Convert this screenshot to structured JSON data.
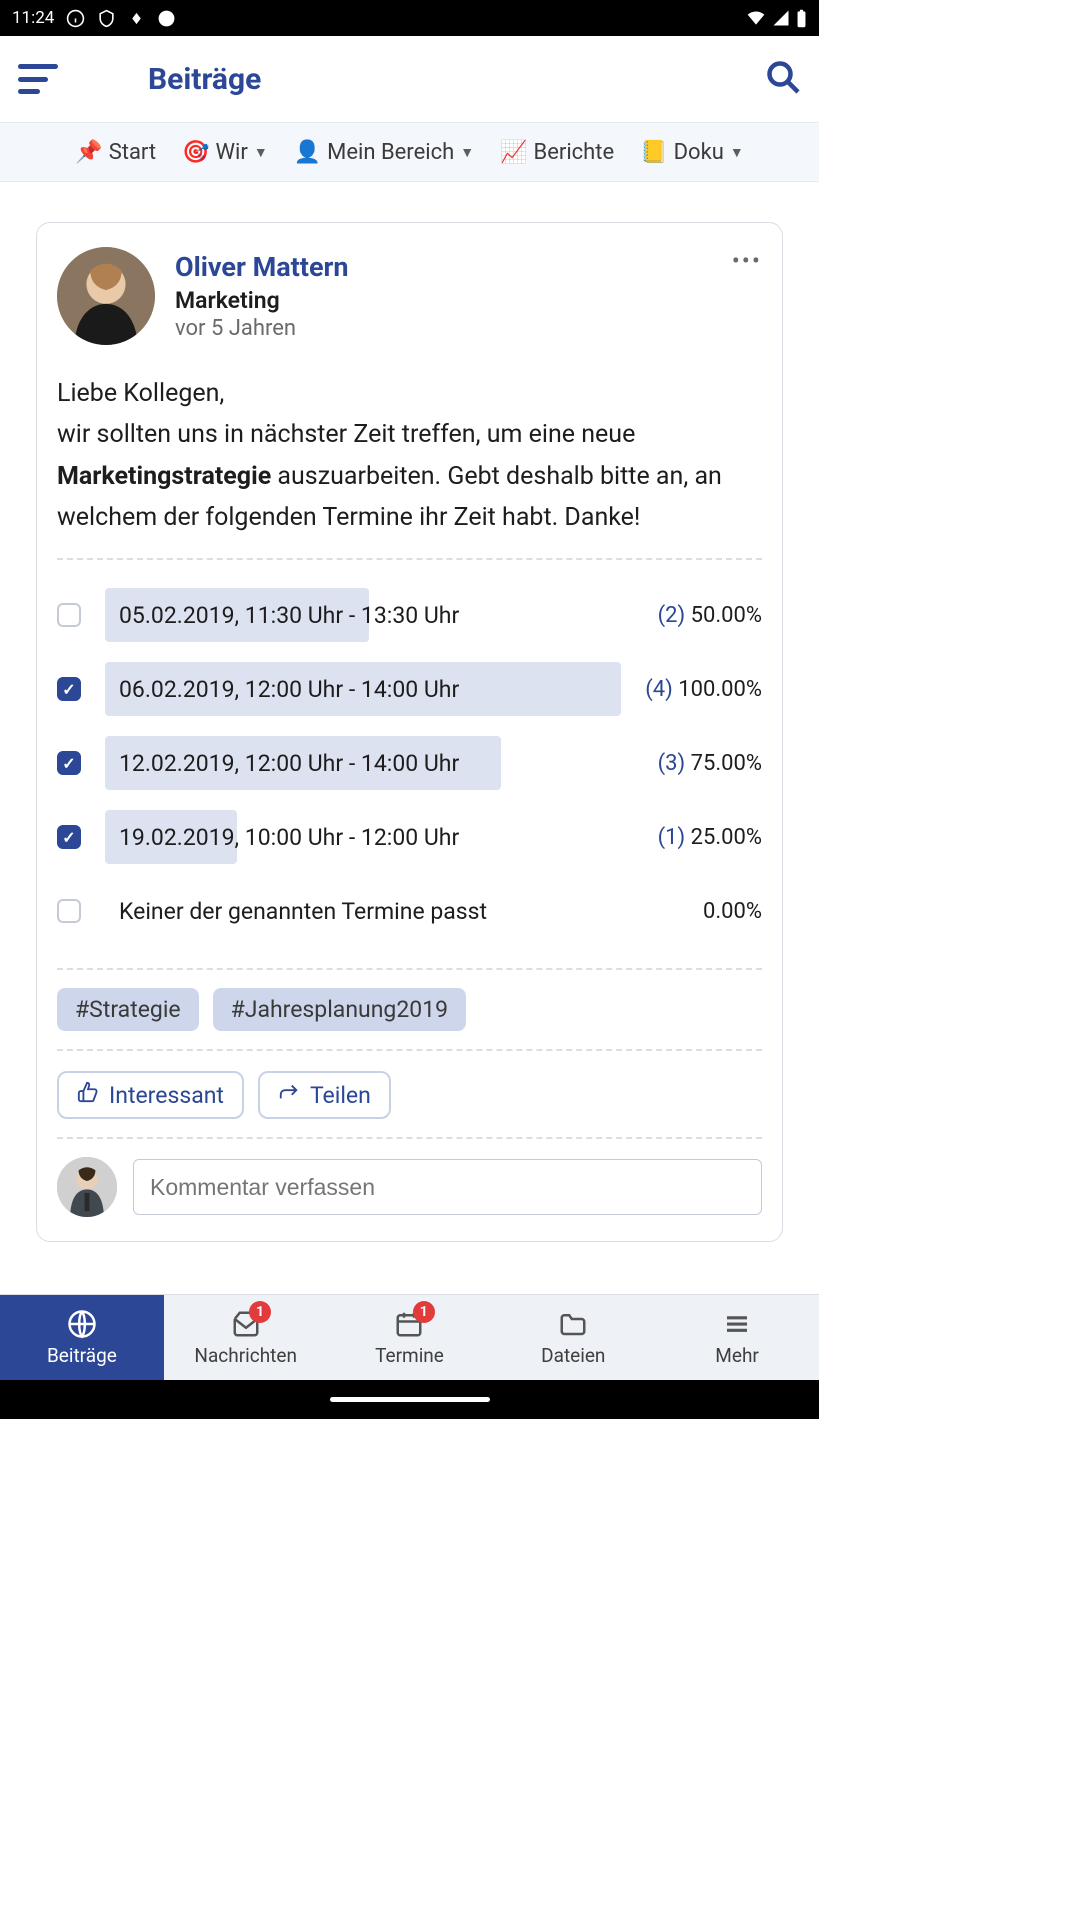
{
  "status": {
    "time": "11:24"
  },
  "header": {
    "title": "Beiträge"
  },
  "nav": {
    "start": "Start",
    "wir": "Wir",
    "bereich": "Mein Bereich",
    "berichte": "Berichte",
    "doku": "Doku"
  },
  "post": {
    "author": "Oliver Mattern",
    "department": "Marketing",
    "time": "vor 5 Jahren",
    "body_line1": "Liebe Kollegen,",
    "body_line2a": "wir sollten uns in nächster Zeit treffen, um eine neue ",
    "body_bold": "Marketingstrategie",
    "body_line2b": " auszuarbeiten. Gebt deshalb bitte an, an welchem der folgenden Termine ihr Zeit habt. Danke!"
  },
  "poll": {
    "options": [
      {
        "label": "05.02.2019, 11:30 Uhr - 13:30 Uhr",
        "checked": false,
        "count": "(2)",
        "pct": "50.00%",
        "bar": 50
      },
      {
        "label": "06.02.2019, 12:00 Uhr - 14:00 Uhr",
        "checked": true,
        "count": "(4)",
        "pct": "100.00%",
        "bar": 100
      },
      {
        "label": "12.02.2019, 12:00 Uhr - 14:00 Uhr",
        "checked": true,
        "count": "(3)",
        "pct": "75.00%",
        "bar": 75
      },
      {
        "label": "19.02.2019, 10:00 Uhr - 12:00 Uhr",
        "checked": true,
        "count": "(1)",
        "pct": "25.00%",
        "bar": 25
      },
      {
        "label": "Keiner der genannten Termine passt",
        "checked": false,
        "count": "",
        "pct": "0.00%",
        "bar": 0
      }
    ]
  },
  "tags": {
    "t1": "#Strategie",
    "t2": "#Jahresplanung2019"
  },
  "actions": {
    "interessant": "Interessant",
    "teilen": "Teilen"
  },
  "comment": {
    "placeholder": "Kommentar verfassen"
  },
  "bottom": {
    "beitraege": "Beiträge",
    "nachrichten": "Nachrichten",
    "termine": "Termine",
    "dateien": "Dateien",
    "mehr": "Mehr",
    "badge1": "1",
    "badge2": "1"
  }
}
